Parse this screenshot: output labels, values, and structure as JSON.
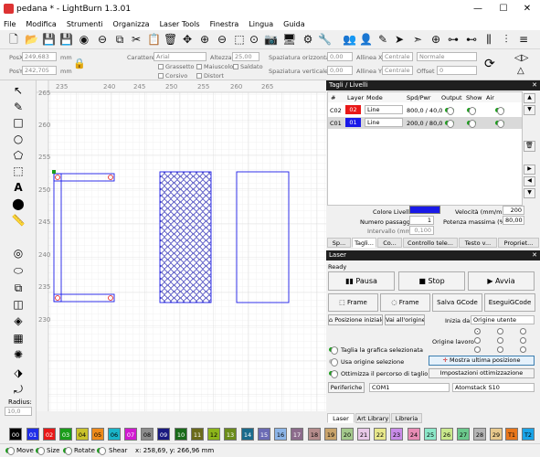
{
  "window": {
    "title": "pedana * - LightBurn 1.3.01",
    "minimize": "—",
    "maximize": "☐",
    "close": "✕"
  },
  "menu": [
    "File",
    "Modifica",
    "Strumenti",
    "Organizza",
    "Laser Tools",
    "Finestra",
    "Lingua",
    "Guida"
  ],
  "toolbar_icons": [
    "new-file-icon",
    "open-folder-icon",
    "save-icon",
    "save-as-icon",
    "import-icon",
    "export-icon",
    "copy-icon",
    "cut-icon",
    "paste-icon",
    "delete-icon",
    "move-icon",
    "zoom-in-icon",
    "zoom-out-icon",
    "zoom-frame-icon",
    "zoom-fit-icon",
    "camera-icon",
    "monitor-icon",
    "settings-icon",
    "tools-icon",
    "users-icon",
    "user-icon",
    "edit-icon",
    "send-icon",
    "target-icon",
    "align-horizontal-icon",
    "align-vertical-icon",
    "distribute-icon"
  ],
  "props": {
    "posx_label": "PosX",
    "posx_value": "249,683",
    "posx_unit": "mm",
    "posy_label": "PosY",
    "posy_value": "242,705",
    "posy_unit": "mm",
    "carattere_label": "Carattere",
    "carattere_value": "Arial",
    "altezza_label": "Altezza",
    "altezza_value": "25,00",
    "grassetto": "Grassetto",
    "maiuscolo": "Maiuscolo",
    "saldato": "Saldato",
    "corsivo": "Corsivo",
    "distort": "Distort",
    "sp_orizz_label": "Spaziatura orizzontale",
    "sp_orizz_value": "0,00",
    "sp_vert_label": "Spaziatura verticale",
    "sp_vert_value": "0,00",
    "allinea_x_label": "Allinea X",
    "allinea_x_value": "Centrale",
    "allinea_y_label": "Allinea Y",
    "allinea_y_value": "Centrale",
    "normale_value": "Normale",
    "offset_label": "Offset",
    "offset_value": "0"
  },
  "left_tools": [
    "select-icon",
    "edit-nodes-icon",
    "rectangle-icon",
    "ellipse-icon",
    "polygon-icon",
    "text-icon",
    "position-laser-icon",
    "measure-icon",
    "offset-icon",
    "weld-icon",
    "array-icon",
    "circular-array-icon",
    "push-pull-icon",
    "rotate-icon"
  ],
  "radius": {
    "label": "Radius:",
    "value": "10,0"
  },
  "ruler": {
    "top": [
      "235",
      "240",
      "245",
      "250",
      "255",
      "260",
      "265"
    ],
    "left": [
      "265",
      "260",
      "255",
      "250",
      "245",
      "240",
      "235",
      "230"
    ]
  },
  "cuts_panel": {
    "title": "Tagli / Livelli",
    "headers": [
      "#",
      "Layer",
      "Mode",
      "Spd/Pwr",
      "Output",
      "Show",
      "Air"
    ],
    "rows": [
      {
        "num": "C02",
        "layer": "02",
        "mode": "Line",
        "spd": "800,0 / 40,0",
        "color": "#e81818"
      },
      {
        "num": "C01",
        "layer": "01",
        "mode": "Line",
        "spd": "200,0 / 80,0",
        "color": "#1a1ae8"
      }
    ],
    "arrow_up": "▲",
    "arrow_down": "▼",
    "arrow_left": "◀",
    "arrow_right": "▶",
    "trash": "🗑",
    "colore_label": "Colore Livello",
    "velocita_label": "Velocità (mm/m)",
    "velocita_value": "200",
    "passaggi_label": "Numero passaggi",
    "passaggi_value": "1",
    "potenza_label": "Potenza massima (%)",
    "potenza_value": "80,00",
    "intervallo_label": "Intervallo (mm)",
    "intervallo_value": "0,100",
    "tabs": [
      "Sp...",
      "Tagli...",
      "Co...",
      "Controllo tele...",
      "Testo v...",
      "Propriet..."
    ]
  },
  "laser_panel": {
    "title": "Laser",
    "status": "Ready",
    "pausa": "Pausa",
    "stop": "Stop",
    "avvia": "Avvia",
    "frame1": "Frame",
    "frame2": "Frame",
    "salva_gcode": "Salva GCode",
    "esegui_gcode": "EseguiGCode",
    "posizione_iniziale": "Posizione iniziale",
    "vai_origine": "Vai all'origine",
    "inizia_da_label": "Inizia da:",
    "inizia_da_value": "Origine utente",
    "origine_lavoro_label": "Origine lavoro",
    "taglia_label": "Taglia la grafica selezionata",
    "usa_origine_label": "Usa origine selezione",
    "ottimizza_label": "Ottimizza il percorso di taglio",
    "mostra_ultima": "Mostra ultima posizione",
    "impostazioni_ott": "Impostazioni ottimizzazione",
    "periferiche": "Periferiche",
    "port_value": "COM1",
    "device_value": "Atomstack S10",
    "tabs": [
      "Laser",
      "Art Library",
      "Libreria"
    ]
  },
  "palette": [
    {
      "label": "00",
      "color": "#000000",
      "text": "#ffffff"
    },
    {
      "label": "01",
      "color": "#1f2de8",
      "text": "#ffffff"
    },
    {
      "label": "02",
      "color": "#e81818",
      "text": "#ffffff"
    },
    {
      "label": "03",
      "color": "#1a9d1a",
      "text": "#ffffff"
    },
    {
      "label": "04",
      "color": "#c9c22a",
      "text": "#000000"
    },
    {
      "label": "05",
      "color": "#ee8a1a",
      "text": "#000000"
    },
    {
      "label": "06",
      "color": "#1ab5c9",
      "text": "#000000"
    },
    {
      "label": "07",
      "color": "#d11ad1",
      "text": "#ffffff"
    },
    {
      "label": "08",
      "color": "#8c8c8c",
      "text": "#000000"
    },
    {
      "label": "09",
      "color": "#1a1a80",
      "text": "#ffffff"
    },
    {
      "label": "10",
      "color": "#1a6b1a",
      "text": "#ffffff"
    },
    {
      "label": "11",
      "color": "#6b6b1a",
      "text": "#ffffff"
    },
    {
      "label": "12",
      "color": "#8cb51a",
      "text": "#000000"
    },
    {
      "label": "13",
      "color": "#6b8c1a",
      "text": "#ffffff"
    },
    {
      "label": "14",
      "color": "#1a6b8c",
      "text": "#ffffff"
    },
    {
      "label": "15",
      "color": "#6b6bb5",
      "text": "#ffffff"
    },
    {
      "label": "16",
      "color": "#8cb5e8",
      "text": "#000000"
    },
    {
      "label": "17",
      "color": "#8c6b8c",
      "text": "#ffffff"
    },
    {
      "label": "18",
      "color": "#b58c8c",
      "text": "#000000"
    },
    {
      "label": "19",
      "color": "#c9a46b",
      "text": "#000000"
    },
    {
      "label": "20",
      "color": "#a4c98c",
      "text": "#000000"
    },
    {
      "label": "21",
      "color": "#e8c9e8",
      "text": "#000000"
    },
    {
      "label": "22",
      "color": "#e8e88c",
      "text": "#000000"
    },
    {
      "label": "23",
      "color": "#c98ce8",
      "text": "#000000"
    },
    {
      "label": "24",
      "color": "#e88cb5",
      "text": "#000000"
    },
    {
      "label": "25",
      "color": "#8ce8c9",
      "text": "#000000"
    },
    {
      "label": "26",
      "color": "#c9e88c",
      "text": "#000000"
    },
    {
      "label": "27",
      "color": "#6bc98c",
      "text": "#000000"
    },
    {
      "label": "28",
      "color": "#b5b5b5",
      "text": "#000000"
    },
    {
      "label": "29",
      "color": "#e8c98c",
      "text": "#000000"
    },
    {
      "label": "T1",
      "color": "#e8761a",
      "text": "#000000"
    },
    {
      "label": "T2",
      "color": "#1aa4e8",
      "text": "#000000"
    }
  ],
  "status": {
    "move": "Move",
    "size": "Size",
    "rotate": "Rotate",
    "shear": "Shear",
    "coords": "x: 258,69, y: 266,96 mm"
  }
}
